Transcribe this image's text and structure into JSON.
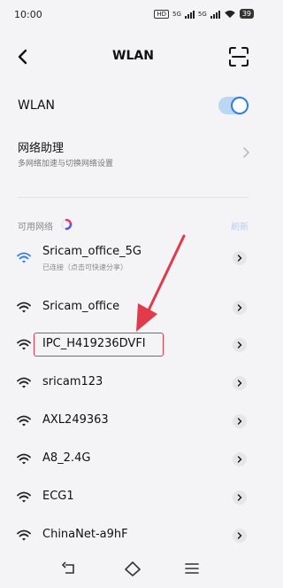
{
  "status_bar": {
    "time": "10:00",
    "network_tags": [
      "5G",
      "5G"
    ],
    "battery": "39"
  },
  "title_bar": {
    "title": "WLAN"
  },
  "wlan": {
    "label": "WLAN",
    "enabled": true
  },
  "assistant": {
    "title": "网络助理",
    "subtitle": "多网络加速与切换网络设置"
  },
  "available": {
    "label": "可用网络",
    "refresh_label": "刷新"
  },
  "networks": [
    {
      "name": "Sricam_office_5G",
      "status": "已连接（点击可快速分享）",
      "connected": true
    },
    {
      "name": "Sricam_office",
      "status": "",
      "connected": false
    },
    {
      "name": "IPC_H419236DVFI",
      "status": "",
      "connected": false
    },
    {
      "name": "sricam123",
      "status": "",
      "connected": false
    },
    {
      "name": "AXL249363",
      "status": "",
      "connected": false
    },
    {
      "name": "A8_2.4G",
      "status": "",
      "connected": false
    },
    {
      "name": "ECG1",
      "status": "",
      "connected": false
    },
    {
      "name": "ChinaNet-a9hF",
      "status": "",
      "connected": false
    }
  ],
  "colors": {
    "accent": "#2e7cf6",
    "annotation": "#e03a4b"
  }
}
